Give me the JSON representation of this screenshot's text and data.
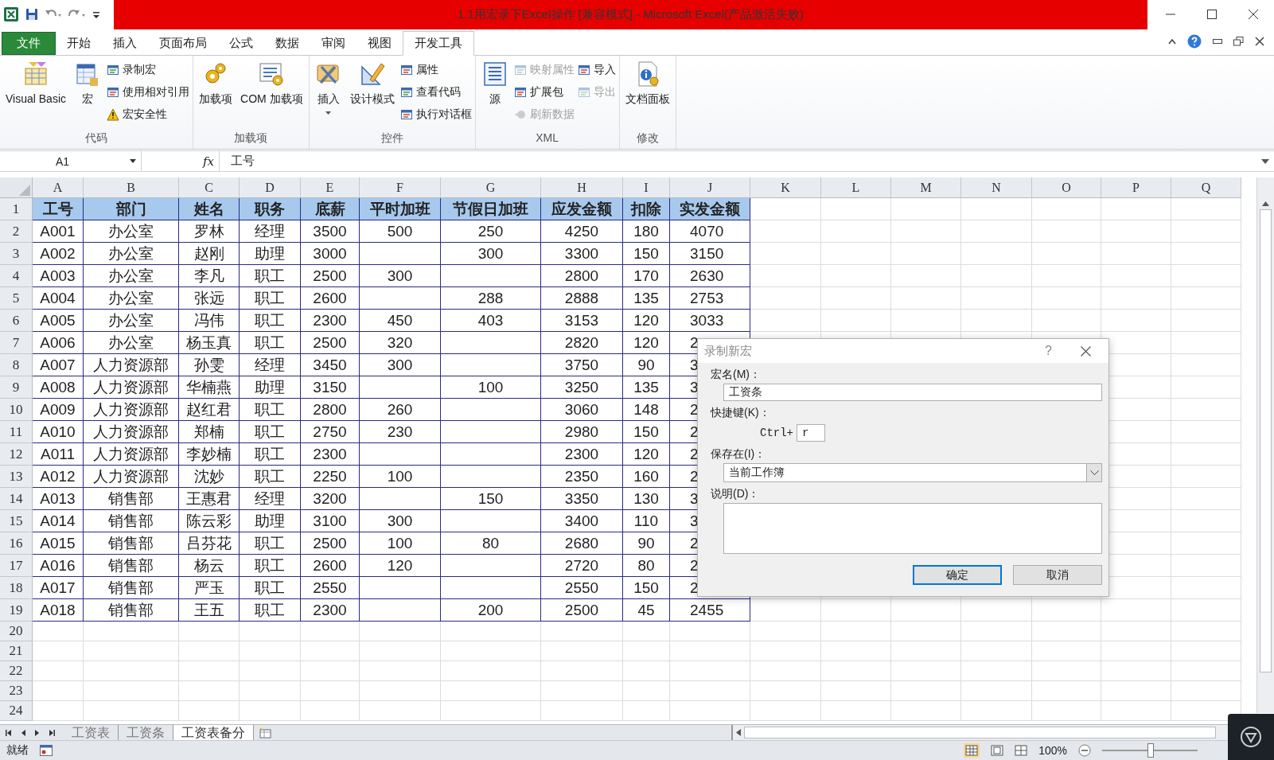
{
  "window": {
    "title": "1.1用宏录下Excel操作  [兼容模式] - Microsoft Excel(产品激活失败)"
  },
  "ribbon_tabs": [
    {
      "label": "文件",
      "kind": "file",
      "selected": false
    },
    {
      "label": "开始",
      "kind": "tab",
      "selected": false
    },
    {
      "label": "插入",
      "kind": "tab",
      "selected": false
    },
    {
      "label": "页面布局",
      "kind": "tab",
      "selected": false
    },
    {
      "label": "公式",
      "kind": "tab",
      "selected": false
    },
    {
      "label": "数据",
      "kind": "tab",
      "selected": false
    },
    {
      "label": "审阅",
      "kind": "tab",
      "selected": false
    },
    {
      "label": "视图",
      "kind": "tab",
      "selected": false
    },
    {
      "label": "开发工具",
      "kind": "tab",
      "selected": true
    }
  ],
  "ribbon_groups": [
    {
      "label": "代码",
      "columns": [
        {
          "kind": "large",
          "label": "Visual Basic"
        },
        {
          "kind": "large",
          "label": "宏"
        },
        {
          "kind": "stack",
          "items": [
            {
              "label": "录制宏",
              "disabled": false
            },
            {
              "label": "使用相对引用",
              "disabled": false
            },
            {
              "label": "宏安全性",
              "disabled": false
            }
          ]
        }
      ]
    },
    {
      "label": "加载项",
      "columns": [
        {
          "kind": "large",
          "label": "加载项"
        },
        {
          "kind": "large",
          "label": "COM 加载项"
        }
      ]
    },
    {
      "label": "控件",
      "columns": [
        {
          "kind": "large",
          "label": "插入",
          "dropdown": true
        },
        {
          "kind": "large",
          "label": "设计模式"
        },
        {
          "kind": "stack",
          "items": [
            {
              "label": "属性",
              "disabled": false
            },
            {
              "label": "查看代码",
              "disabled": false
            },
            {
              "label": "执行对话框",
              "disabled": false
            }
          ]
        }
      ]
    },
    {
      "label": "XML",
      "columns": [
        {
          "kind": "large",
          "label": "源"
        },
        {
          "kind": "stack",
          "items": [
            {
              "label": "映射属性",
              "disabled": true
            },
            {
              "label": "扩展包",
              "disabled": false
            },
            {
              "label": "刷新数据",
              "disabled": true
            }
          ]
        },
        {
          "kind": "stack",
          "items": [
            {
              "label": "导入",
              "disabled": false
            },
            {
              "label": "导出",
              "disabled": true
            }
          ]
        }
      ]
    },
    {
      "label": "修改",
      "columns": [
        {
          "kind": "large",
          "label": "文档面板"
        }
      ]
    }
  ],
  "formula_bar": {
    "name_box": "A1",
    "function_label": "fx",
    "formula": "工号"
  },
  "sheet": {
    "columns": [
      "A",
      "B",
      "C",
      "D",
      "E",
      "F",
      "G",
      "H",
      "I",
      "J",
      "K",
      "L",
      "M",
      "N",
      "O",
      "P",
      "Q"
    ],
    "rows": [
      {
        "number": "1",
        "kind": "header",
        "cells": [
          "工号",
          "部门",
          "姓名",
          "职务",
          "底薪",
          "平时加班",
          "节假日加班",
          "应发金额",
          "扣除",
          "实发金额"
        ]
      },
      {
        "number": "2",
        "kind": "data",
        "cells": [
          "A001",
          "办公室",
          "罗林",
          "经理",
          "3500",
          "500",
          "250",
          "4250",
          "180",
          "4070"
        ]
      },
      {
        "number": "3",
        "kind": "data",
        "cells": [
          "A002",
          "办公室",
          "赵刚",
          "助理",
          "3000",
          null,
          "300",
          "3300",
          "150",
          "3150"
        ]
      },
      {
        "number": "4",
        "kind": "data",
        "cells": [
          "A003",
          "办公室",
          "李凡",
          "职工",
          "2500",
          "300",
          null,
          "2800",
          "170",
          "2630"
        ]
      },
      {
        "number": "5",
        "kind": "data",
        "cells": [
          "A004",
          "办公室",
          "张远",
          "职工",
          "2600",
          null,
          "288",
          "2888",
          "135",
          "2753"
        ]
      },
      {
        "number": "6",
        "kind": "data",
        "cells": [
          "A005",
          "办公室",
          "冯伟",
          "职工",
          "2300",
          "450",
          "403",
          "3153",
          "120",
          "3033"
        ]
      },
      {
        "number": "7",
        "kind": "data",
        "cells": [
          "A006",
          "办公室",
          "杨玉真",
          "职工",
          "2500",
          "320",
          null,
          "2820",
          "120",
          "2"
        ]
      },
      {
        "number": "8",
        "kind": "data",
        "cells": [
          "A007",
          "人力资源部",
          "孙雯",
          "经理",
          "3450",
          "300",
          null,
          "3750",
          "90",
          "3"
        ]
      },
      {
        "number": "9",
        "kind": "data",
        "cells": [
          "A008",
          "人力资源部",
          "华楠燕",
          "助理",
          "3150",
          null,
          "100",
          "3250",
          "135",
          "3"
        ]
      },
      {
        "number": "10",
        "kind": "data",
        "cells": [
          "A009",
          "人力资源部",
          "赵红君",
          "职工",
          "2800",
          "260",
          null,
          "3060",
          "148",
          "2"
        ]
      },
      {
        "number": "11",
        "kind": "data",
        "cells": [
          "A010",
          "人力资源部",
          "郑楠",
          "职工",
          "2750",
          "230",
          null,
          "2980",
          "150",
          "2"
        ]
      },
      {
        "number": "12",
        "kind": "data",
        "cells": [
          "A011",
          "人力资源部",
          "李妙楠",
          "职工",
          "2300",
          null,
          null,
          "2300",
          "120",
          "2"
        ]
      },
      {
        "number": "13",
        "kind": "data",
        "cells": [
          "A012",
          "人力资源部",
          "沈妙",
          "职工",
          "2250",
          "100",
          null,
          "2350",
          "160",
          "2"
        ]
      },
      {
        "number": "14",
        "kind": "data",
        "cells": [
          "A013",
          "销售部",
          "王惠君",
          "经理",
          "3200",
          null,
          "150",
          "3350",
          "130",
          "3"
        ]
      },
      {
        "number": "15",
        "kind": "data",
        "cells": [
          "A014",
          "销售部",
          "陈云彩",
          "助理",
          "3100",
          "300",
          null,
          "3400",
          "110",
          "3"
        ]
      },
      {
        "number": "16",
        "kind": "data",
        "cells": [
          "A015",
          "销售部",
          "吕芬花",
          "职工",
          "2500",
          "100",
          "80",
          "2680",
          "90",
          "2"
        ]
      },
      {
        "number": "17",
        "kind": "data",
        "cells": [
          "A016",
          "销售部",
          "杨云",
          "职工",
          "2600",
          "120",
          null,
          "2720",
          "80",
          "2"
        ]
      },
      {
        "number": "18",
        "kind": "data",
        "cells": [
          "A017",
          "销售部",
          "严玉",
          "职工",
          "2550",
          null,
          null,
          "2550",
          "150",
          "2"
        ]
      },
      {
        "number": "19",
        "kind": "data",
        "cells": [
          "A018",
          "销售部",
          "王五",
          "职工",
          "2300",
          null,
          "200",
          "2500",
          "45",
          "2455"
        ]
      },
      {
        "number": "20",
        "kind": "empty",
        "cells": []
      },
      {
        "number": "21",
        "kind": "empty",
        "cells": []
      },
      {
        "number": "22",
        "kind": "empty",
        "cells": []
      },
      {
        "number": "23",
        "kind": "empty",
        "cells": []
      },
      {
        "number": "24",
        "kind": "empty",
        "cells": []
      }
    ]
  },
  "sheet_tabs": [
    {
      "label": "工资表",
      "selected": false
    },
    {
      "label": "工资条",
      "selected": false
    },
    {
      "label": "工资表备分",
      "selected": true
    }
  ],
  "status_bar": {
    "status": "就绪",
    "zoom": "100%",
    "zoom_slider": {
      "level": 0.5
    }
  },
  "dialog": {
    "title": "录制新宏",
    "help": "?",
    "name_label": "宏名(M)：",
    "name_value": "工资条",
    "shortcut_label": "快捷键(K)：",
    "ctrl_label": "Ctrl+",
    "shortcut_value": "r",
    "store_label": "保存在(I)：",
    "store_value": "当前工作簿",
    "description_label": "说明(D)：",
    "buttons": [
      {
        "label": "确定",
        "default": true
      },
      {
        "label": "取消",
        "default": false
      }
    ]
  }
}
